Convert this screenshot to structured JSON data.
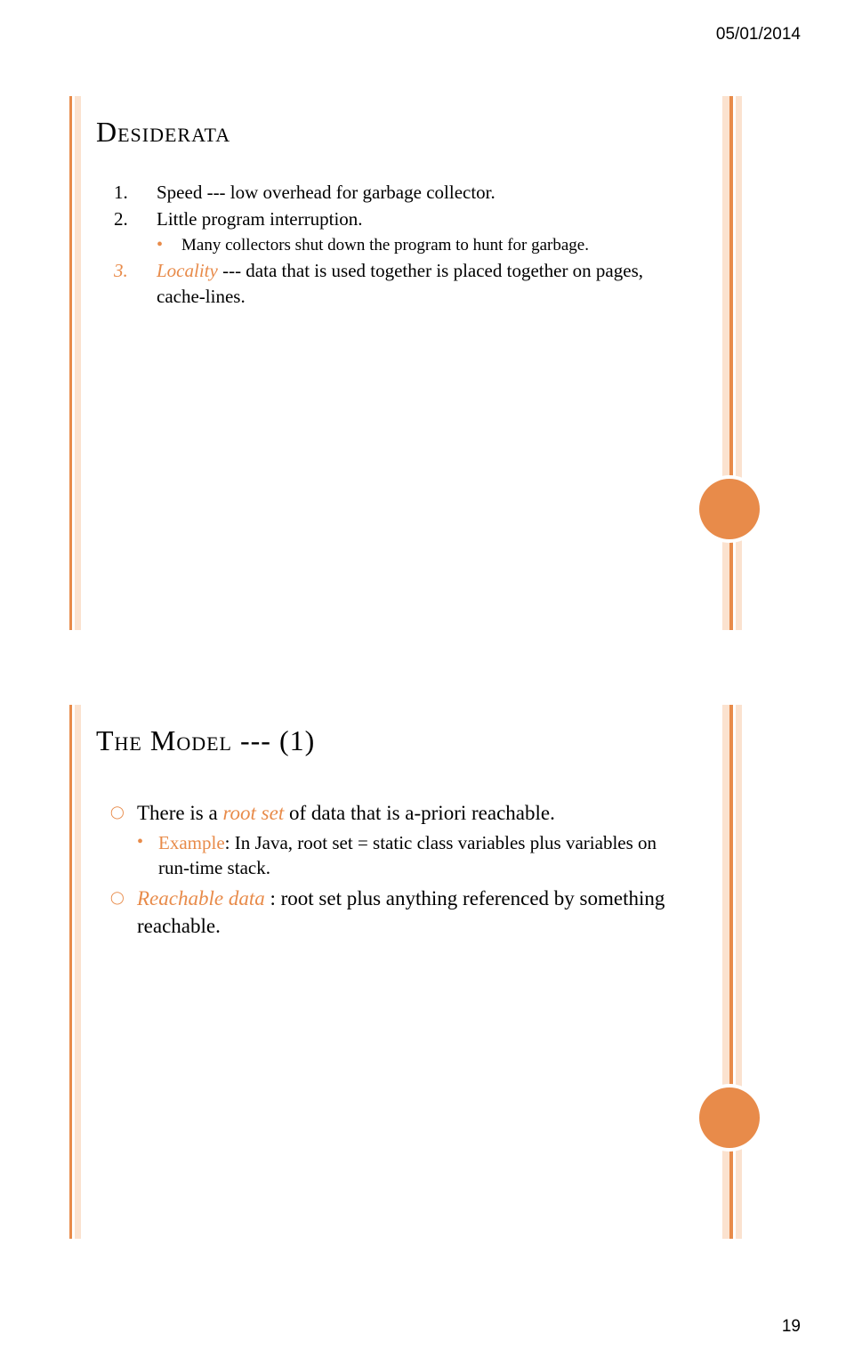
{
  "header": {
    "date": "05/01/2014"
  },
  "footer": {
    "page": "19"
  },
  "slide1": {
    "title": "Desiderata",
    "items": [
      {
        "n": "1.",
        "text": "Speed --- low overhead for garbage collector."
      },
      {
        "n": "2.",
        "text": "Little program interruption."
      }
    ],
    "sub2": "Many collectors shut down the program to hunt for garbage.",
    "item3": {
      "n": "3.",
      "em": "Locality",
      "rest": " --- data that is used together is placed together on pages, cache-lines."
    }
  },
  "slide2": {
    "title": "The Model --- (1)",
    "p1_a": "There is a ",
    "p1_em": "root set",
    "p1_b": "  of data that is a-priori reachable.",
    "sub_em": "Example",
    "sub_rest": ": In Java, root set = static class variables plus variables on run-time stack.",
    "p2_em": "Reachable data",
    "p2_rest": " : root set plus anything referenced by something reachable."
  }
}
